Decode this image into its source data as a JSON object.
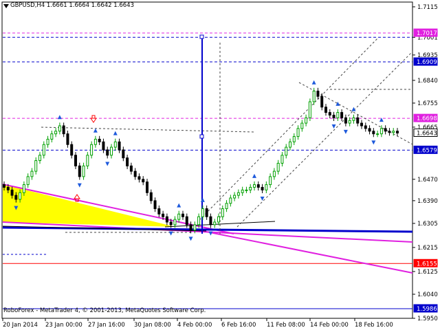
{
  "header": {
    "title": "GBPUSD,H4  1.6661 1.6664 1.6642 1.6643",
    "menu_icon": "triangle-down-icon"
  },
  "footer": {
    "copyright": "RoboForex - MetaTrader 4, © 2001-2013, MetaQuotes Software Corp."
  },
  "colors": {
    "up_bar": "#00a000",
    "down_bar": "#000000",
    "fractal": "#1e5adc",
    "magenta": "#e020e0",
    "red": "#ff0000",
    "blue": "#0000cc",
    "yellow": "#ffff00",
    "badge_text": "#ffffff"
  },
  "chart_data": {
    "type": "candlestick",
    "symbol": "GBPUSD",
    "timeframe": "H4",
    "ohlc": {
      "open": 1.6661,
      "high": 1.6664,
      "low": 1.6642,
      "close": 1.6643
    },
    "ylim": [
      1.595,
      1.712
    ],
    "y_ticks": [
      "1.7115",
      "1.7001",
      "1.6935",
      "1.6840",
      "1.6755",
      "1.6665",
      "1.6470",
      "1.6390",
      "1.6305",
      "1.6215",
      "1.6125",
      "1.6040",
      "1.5950"
    ],
    "x_ticks": [
      "20 Jan 2014",
      "23 Jan 00:00",
      "27 Jan 16:00",
      "30 Jan 08:00",
      "4 Feb 00:00",
      "6 Feb 16:00",
      "11 Feb 08:00",
      "14 Feb 00:00",
      "18 Feb 16:00"
    ],
    "price_badges": [
      {
        "value": "1.7017",
        "color": "#e020e0"
      },
      {
        "value": "1.6909",
        "color": "#0000cc"
      },
      {
        "value": "1.6698",
        "color": "#e020e0"
      },
      {
        "value": "1.6643",
        "color": "#ffffff"
      },
      {
        "value": "1.6579",
        "color": "#0000cc"
      },
      {
        "value": "1.6155",
        "color": "#ff0000"
      },
      {
        "value": "1.5986",
        "color": "#0000cc"
      }
    ],
    "horizontal_levels": [
      {
        "price": 1.7017,
        "style": "dashed",
        "color": "#e020e0"
      },
      {
        "price": 1.7001,
        "style": "dashed",
        "color": "#0000cc"
      },
      {
        "price": 1.6909,
        "style": "dashed",
        "color": "#0000cc"
      },
      {
        "price": 1.6698,
        "style": "dashed",
        "color": "#e020e0"
      },
      {
        "price": 1.6579,
        "style": "dashed",
        "color": "#0000cc"
      },
      {
        "price": 1.6155,
        "style": "solid",
        "color": "#ff0000"
      },
      {
        "price": 1.5986,
        "style": "solid",
        "color": "#0000cc"
      }
    ],
    "close_series": [
      1.644,
      1.643,
      1.641,
      1.6395,
      1.642,
      1.645,
      1.648,
      1.65,
      1.654,
      1.656,
      1.66,
      1.662,
      1.664,
      1.665,
      1.667,
      1.664,
      1.66,
      1.656,
      1.652,
      1.648,
      1.652,
      1.656,
      1.66,
      1.662,
      1.661,
      1.658,
      1.656,
      1.659,
      1.661,
      1.658,
      1.655,
      1.652,
      1.65,
      1.648,
      1.647,
      1.646,
      1.642,
      1.639,
      1.636,
      1.634,
      1.633,
      1.631,
      1.63,
      1.632,
      1.634,
      1.633,
      1.63,
      1.628,
      1.63,
      1.633,
      1.636,
      1.633,
      1.63,
      1.631,
      1.633,
      1.636,
      1.638,
      1.64,
      1.641,
      1.642,
      1.643,
      1.643,
      1.644,
      1.645,
      1.644,
      1.643,
      1.645,
      1.648,
      1.65,
      1.653,
      1.656,
      1.659,
      1.661,
      1.663,
      1.666,
      1.668,
      1.67,
      1.676,
      1.68,
      1.678,
      1.674,
      1.672,
      1.671,
      1.67,
      1.672,
      1.67,
      1.668,
      1.669,
      1.67,
      1.668,
      1.667,
      1.666,
      1.665,
      1.664,
      1.664,
      1.666,
      1.665,
      1.6645,
      1.665,
      1.6643
    ]
  }
}
